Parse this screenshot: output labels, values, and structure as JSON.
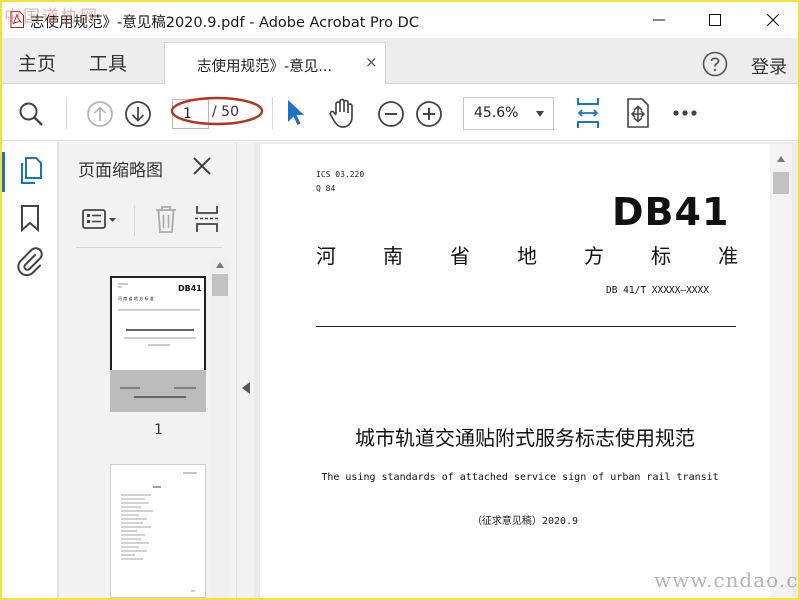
{
  "window": {
    "title": "志使用规范》-意见稿2020.9.pdf - Adobe Acrobat Pro DC",
    "watermark_top": "中国道协网",
    "accent_color": "#1a73c9"
  },
  "tabs": {
    "home": "主页",
    "tools": "工具",
    "document_tab": "志使用规范》-意见...",
    "close_glyph": "×",
    "login": "登录"
  },
  "toolbar": {
    "current_page": "1",
    "total_pages": "/ 50",
    "zoom": "45.6%"
  },
  "thumbnails_panel": {
    "title": "页面缩略图",
    "page1_number": "1"
  },
  "document": {
    "ics": "ICS  03.220",
    "q": "Q 84",
    "db_code": "DB41",
    "province_chars": [
      "河",
      "南",
      "省",
      "地",
      "方",
      "标",
      "准"
    ],
    "standard_number": "DB 41/T XXXXX—XXXX",
    "cn_title": "城市轨道交通贴附式服务标志使用规范",
    "en_title": "The using standards of attached service sign of urban rail transit",
    "draft_label": "（征求意见稿）",
    "draft_date": "2020.9"
  },
  "watermark": "www.cndao.com"
}
